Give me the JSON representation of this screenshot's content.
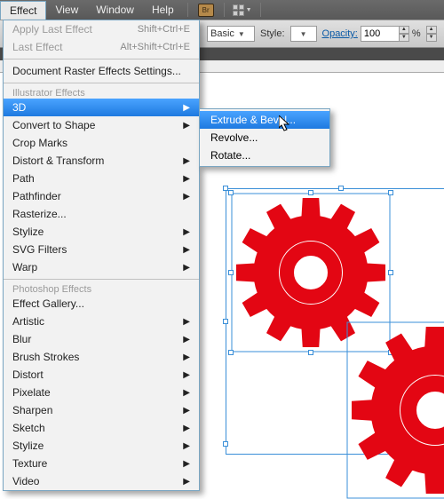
{
  "menubar": {
    "items": [
      "Effect",
      "View",
      "Window",
      "Help"
    ],
    "open_index": 0,
    "br_label": "Br"
  },
  "ctrlbar": {
    "basic_label": "Basic",
    "style_label": "Style:",
    "opacity_label": "Opacity:",
    "opacity_value": "100",
    "percent": "%"
  },
  "dropdown": {
    "recent": [
      {
        "label": "Apply Last Effect",
        "shortcut": "Shift+Ctrl+E"
      },
      {
        "label": "Last Effect",
        "shortcut": "Alt+Shift+Ctrl+E"
      }
    ],
    "raster": "Document Raster Effects Settings...",
    "ill_header": "Illustrator Effects",
    "ill_items": [
      {
        "label": "3D",
        "sub": true,
        "sel": true
      },
      {
        "label": "Convert to Shape",
        "sub": true
      },
      {
        "label": "Crop Marks"
      },
      {
        "label": "Distort & Transform",
        "sub": true
      },
      {
        "label": "Path",
        "sub": true
      },
      {
        "label": "Pathfinder",
        "sub": true
      },
      {
        "label": "Rasterize..."
      },
      {
        "label": "Stylize",
        "sub": true
      },
      {
        "label": "SVG Filters",
        "sub": true
      },
      {
        "label": "Warp",
        "sub": true
      }
    ],
    "ps_header": "Photoshop Effects",
    "ps_items": [
      {
        "label": "Effect Gallery..."
      },
      {
        "label": "Artistic",
        "sub": true
      },
      {
        "label": "Blur",
        "sub": true
      },
      {
        "label": "Brush Strokes",
        "sub": true
      },
      {
        "label": "Distort",
        "sub": true
      },
      {
        "label": "Pixelate",
        "sub": true
      },
      {
        "label": "Sharpen",
        "sub": true
      },
      {
        "label": "Sketch",
        "sub": true
      },
      {
        "label": "Stylize",
        "sub": true
      },
      {
        "label": "Texture",
        "sub": true
      },
      {
        "label": "Video",
        "sub": true
      }
    ]
  },
  "submenu": {
    "items": [
      {
        "label": "Extrude & Bevel...",
        "sel": true
      },
      {
        "label": "Revolve..."
      },
      {
        "label": "Rotate..."
      }
    ]
  },
  "gears": {
    "color": "#e30613"
  }
}
